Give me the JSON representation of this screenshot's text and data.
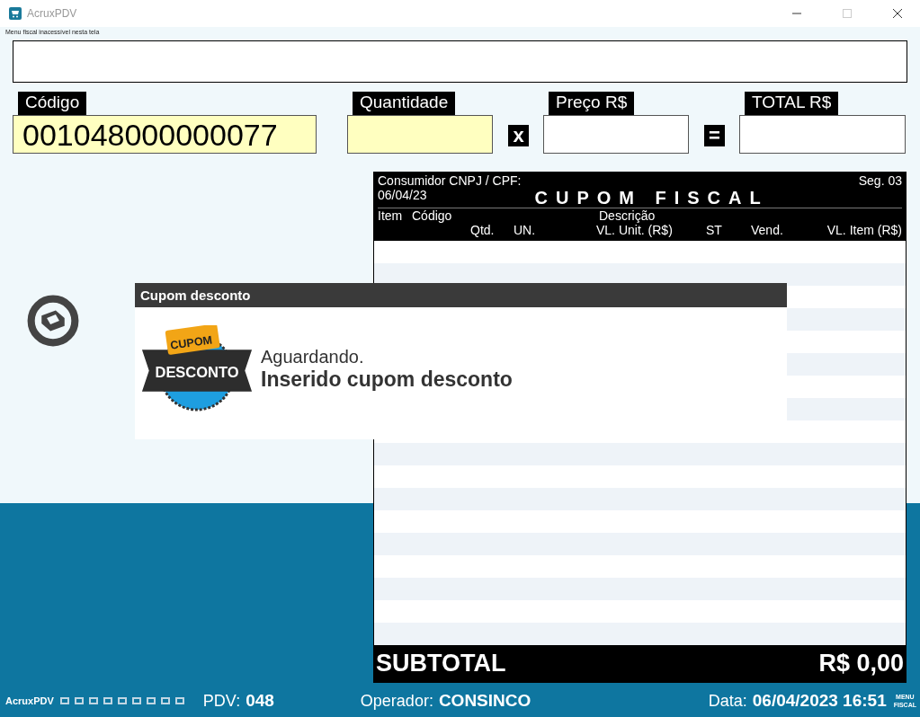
{
  "window": {
    "title": "AcruxPDV"
  },
  "notice": "Menu fiscal inacessível nesta tela",
  "fields": [
    {
      "label": "Código",
      "value": "001048000000077",
      "highlighted": true
    },
    {
      "label": "Quantidade",
      "highlighted": true,
      "operator": "x"
    },
    {
      "label": "Preço R$",
      "highlighted": false,
      "operator": "="
    },
    {
      "label": "TOTAL R$",
      "highlighted": false
    }
  ],
  "receipt": {
    "consumer": "Consumidor CNPJ / CPF:",
    "date": "06/04/23",
    "title": "CUPOM FISCAL",
    "seq": "Seg. 03",
    "columns_line1": [
      "Item",
      "Código",
      "Descrição"
    ],
    "columns_line2": [
      "Qtd.",
      "UN.",
      "VL. Unit. (R$)",
      "ST",
      "Vend.",
      "VL. Item (R$)"
    ],
    "subtotal_label": "SUBTOTAL",
    "subtotal_value": "R$ 0,00"
  },
  "dialog": {
    "title": "Cupom desconto",
    "badge_top": "CUPOM",
    "badge_main": "DESCONTO",
    "status": "Aguardando.",
    "message": "Inserido cupom desconto"
  },
  "status_bar": {
    "app": "AcruxPDV",
    "pdv_label": "PDV:",
    "pdv": "048",
    "operator_label": "Operador:",
    "operator": "CONSINCO",
    "date_label": "Data:",
    "date": "06/04/2023 16:51",
    "menu_top": "MENU",
    "menu_bottom": "FISCAL"
  }
}
